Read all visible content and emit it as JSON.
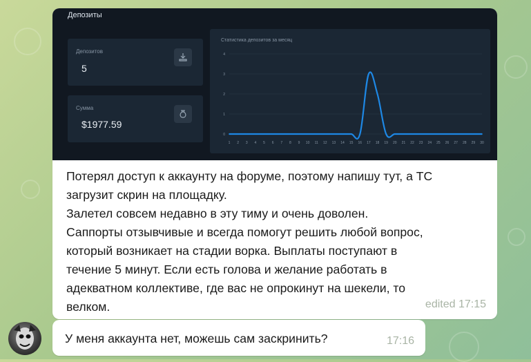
{
  "screenshot": {
    "title": "Депозиты",
    "cards": [
      {
        "label": "Депозитов",
        "value": "5",
        "icon": "deposit-icon"
      },
      {
        "label": "Сумма",
        "value": "$1977.59",
        "icon": "money-bag-icon"
      }
    ],
    "chart_title": "Статистика депозитов за месяц"
  },
  "chart_data": {
    "type": "line",
    "title": "Статистика депозитов за месяц",
    "x": [
      1,
      2,
      3,
      4,
      5,
      6,
      7,
      8,
      9,
      10,
      11,
      12,
      13,
      14,
      15,
      16,
      17,
      18,
      19,
      20,
      21,
      22,
      23,
      24,
      25,
      26,
      27,
      28,
      29,
      30
    ],
    "values": [
      0,
      0,
      0,
      0,
      0,
      0,
      0,
      0,
      0,
      0,
      0,
      0,
      0,
      0,
      0,
      0,
      3,
      2,
      0,
      0,
      0,
      0,
      0,
      0,
      0,
      0,
      0,
      0,
      0,
      0
    ],
    "ylim": [
      0,
      4
    ],
    "yticks": [
      0,
      1,
      2,
      3,
      4
    ],
    "grid": true,
    "line_color": "#1e88e5"
  },
  "message": {
    "text": "Потерял доступ к аккаунту на форуме, поэтому напишу тут, а ТС\nзагрузит скрин на площадку.\nЗалетел совсем недавно в эту тиму и очень доволен.\nСаппорты отзывчивые и всегда помогут решить любой вопрос,\nкоторый возникает на стадии ворка. Выплаты поступают в\nтечение 5 минут. Если есть голова и желание работать в\nадекватном коллективе, где вас не опрокинут на шекели, то\nвелком.",
    "time": "edited 17:15"
  },
  "reply": {
    "text": "У меня аккаунта нет, можешь сам заскринить?",
    "time": "17:16"
  }
}
